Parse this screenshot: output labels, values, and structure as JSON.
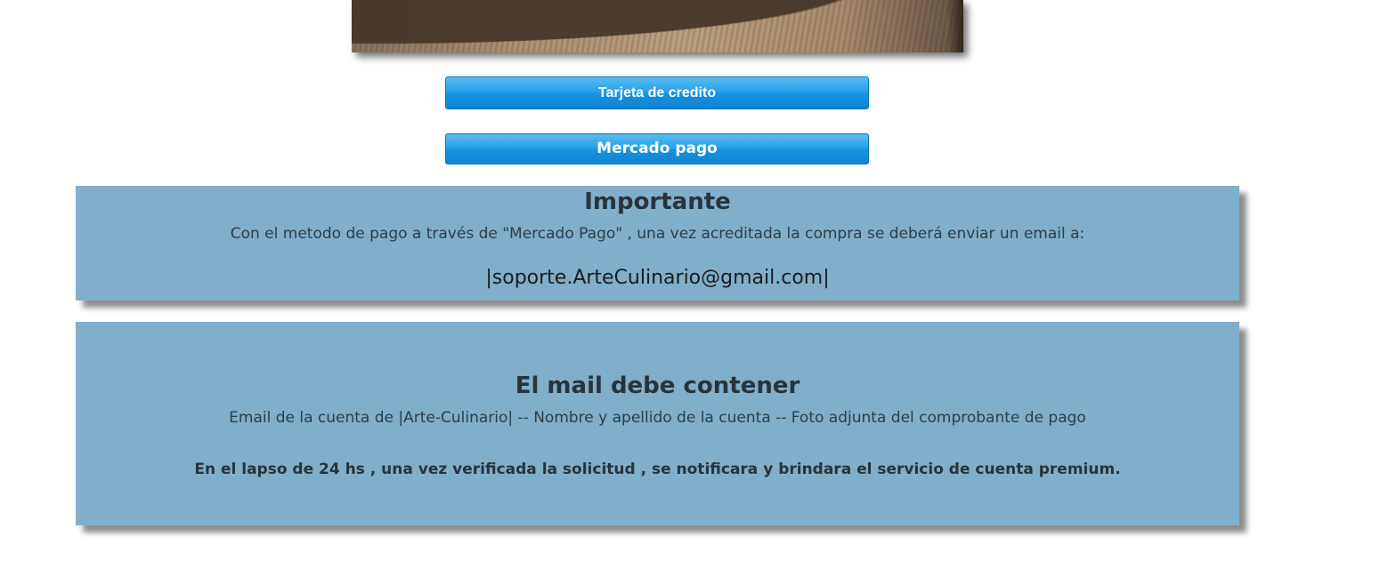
{
  "buttons": {
    "credit_card": "Tarjeta de credito",
    "mercado_pago": "Mercado pago"
  },
  "important": {
    "title": "Importante",
    "text": "Con el metodo de pago a través de \"Mercado Pago\" , una vez acreditada la compra se deberá enviar un email a:",
    "email": "|soporte.ArteCulinario@gmail.com|"
  },
  "mail_requirements": {
    "title": "El mail debe contener",
    "text": "Email de la cuenta de |Arte-Culinario| -- Nombre y apellido de la cuenta -- Foto adjunta del comprobante de pago",
    "note": "En el lapso de 24 hs , una vez verificada la solicitud , se notificara y brindara el servicio de cuenta premium."
  },
  "colors": {
    "button_blue": "#1592e0",
    "info_box_bg": "#80aecb",
    "info_text": "#2d3e48"
  }
}
